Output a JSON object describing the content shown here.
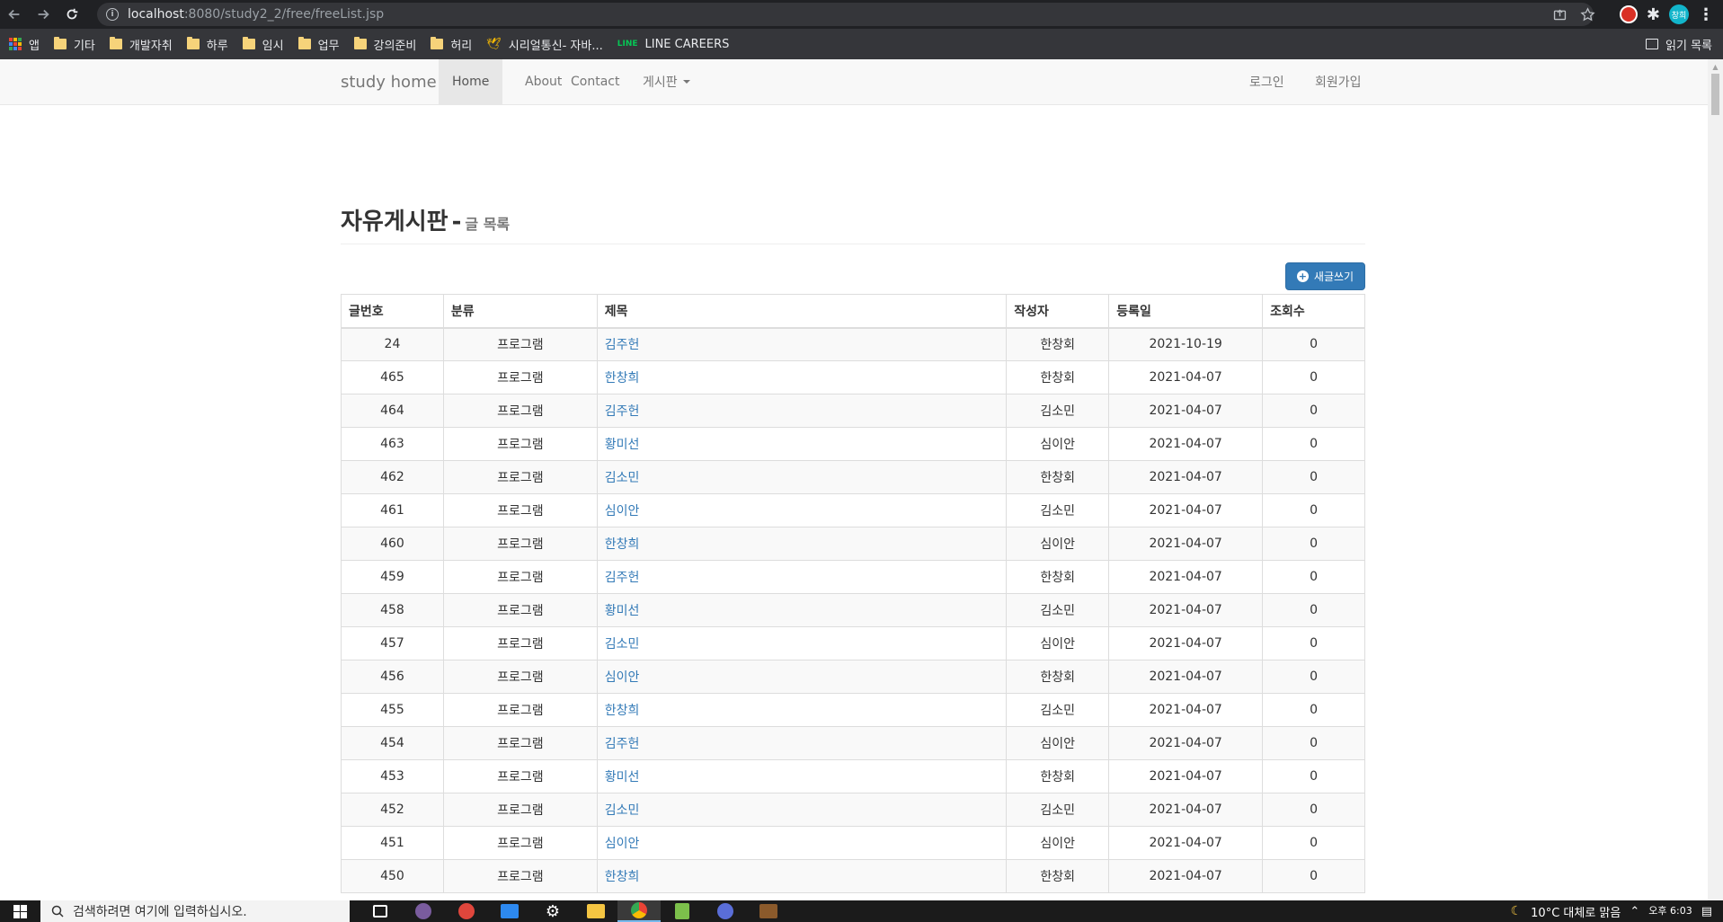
{
  "browser": {
    "url_host": "localhost",
    "url_path": ":8080/study2_2/free/freeList.jsp",
    "profile_initials": "창희",
    "bookmarks": [
      {
        "label": "앱",
        "icon": "apps-grid-icon"
      },
      {
        "label": "기타",
        "icon": "folder-icon"
      },
      {
        "label": "개발자취",
        "icon": "folder-icon"
      },
      {
        "label": "하루",
        "icon": "folder-icon"
      },
      {
        "label": "임시",
        "icon": "folder-icon"
      },
      {
        "label": "업무",
        "icon": "folder-icon"
      },
      {
        "label": "강의준비",
        "icon": "folder-icon"
      },
      {
        "label": "허리",
        "icon": "folder-icon"
      },
      {
        "label": "시리얼통신- 자바...",
        "icon": "bird-icon"
      },
      {
        "label": "LINE CAREERS",
        "icon": "line-icon"
      }
    ],
    "reading_list": "읽기 목록"
  },
  "navbar": {
    "brand": "study home",
    "items": [
      "Home",
      "About",
      "Contact",
      "게시판"
    ],
    "right_items": [
      "로그인",
      "회원가입"
    ]
  },
  "header": {
    "title": "자유게시판",
    "separator": "-",
    "subtitle": "글 목록"
  },
  "new_post_button": "새글쓰기",
  "table": {
    "columns": [
      "글번호",
      "분류",
      "제목",
      "작성자",
      "등록일",
      "조회수"
    ],
    "rows": [
      {
        "no": "24",
        "category": "프로그램",
        "title": "김주헌",
        "writer": "한창회",
        "date": "2021-10-19",
        "views": "0"
      },
      {
        "no": "465",
        "category": "프로그램",
        "title": "한창희",
        "writer": "한창회",
        "date": "2021-04-07",
        "views": "0"
      },
      {
        "no": "464",
        "category": "프로그램",
        "title": "김주헌",
        "writer": "김소민",
        "date": "2021-04-07",
        "views": "0"
      },
      {
        "no": "463",
        "category": "프로그램",
        "title": "황미선",
        "writer": "심이안",
        "date": "2021-04-07",
        "views": "0"
      },
      {
        "no": "462",
        "category": "프로그램",
        "title": "김소민",
        "writer": "한창회",
        "date": "2021-04-07",
        "views": "0"
      },
      {
        "no": "461",
        "category": "프로그램",
        "title": "심이안",
        "writer": "김소민",
        "date": "2021-04-07",
        "views": "0"
      },
      {
        "no": "460",
        "category": "프로그램",
        "title": "한창희",
        "writer": "심이안",
        "date": "2021-04-07",
        "views": "0"
      },
      {
        "no": "459",
        "category": "프로그램",
        "title": "김주헌",
        "writer": "한창회",
        "date": "2021-04-07",
        "views": "0"
      },
      {
        "no": "458",
        "category": "프로그램",
        "title": "황미선",
        "writer": "김소민",
        "date": "2021-04-07",
        "views": "0"
      },
      {
        "no": "457",
        "category": "프로그램",
        "title": "김소민",
        "writer": "심이안",
        "date": "2021-04-07",
        "views": "0"
      },
      {
        "no": "456",
        "category": "프로그램",
        "title": "심이안",
        "writer": "한창회",
        "date": "2021-04-07",
        "views": "0"
      },
      {
        "no": "455",
        "category": "프로그램",
        "title": "한창희",
        "writer": "김소민",
        "date": "2021-04-07",
        "views": "0"
      },
      {
        "no": "454",
        "category": "프로그램",
        "title": "김주헌",
        "writer": "심이안",
        "date": "2021-04-07",
        "views": "0"
      },
      {
        "no": "453",
        "category": "프로그램",
        "title": "황미선",
        "writer": "한창회",
        "date": "2021-04-07",
        "views": "0"
      },
      {
        "no": "452",
        "category": "프로그램",
        "title": "김소민",
        "writer": "김소민",
        "date": "2021-04-07",
        "views": "0"
      },
      {
        "no": "451",
        "category": "프로그램",
        "title": "심이안",
        "writer": "심이안",
        "date": "2021-04-07",
        "views": "0"
      },
      {
        "no": "450",
        "category": "프로그램",
        "title": "한창희",
        "writer": "한창회",
        "date": "2021-04-07",
        "views": "0"
      }
    ]
  },
  "taskbar": {
    "search_placeholder": "검색하려면 여기에 입력하십시오.",
    "weather": "10°C 대체로 맑음",
    "time": "오후 6:03"
  },
  "colors": {
    "link": "#337ab7",
    "button": "#337ab7",
    "navbar_bg": "#f8f8f8",
    "browser_chrome": "#202124"
  }
}
